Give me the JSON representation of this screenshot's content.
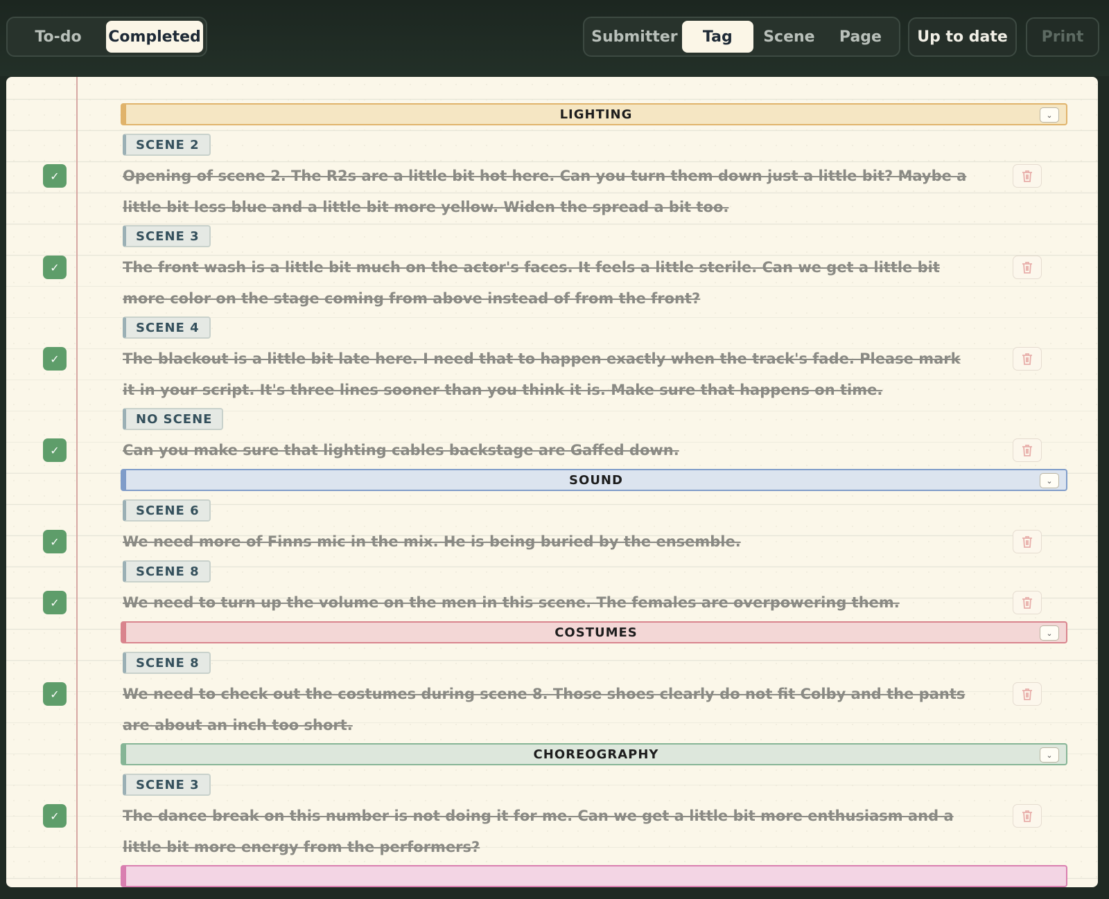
{
  "toolbar": {
    "view_toggle": [
      "To-do",
      "Completed"
    ],
    "active_view": "Completed",
    "group_by": [
      "Submitter",
      "Tag",
      "Scene",
      "Page"
    ],
    "active_group": "Tag",
    "sync_status": "Up to date",
    "print_label": "Print"
  },
  "icons": {
    "check": "✓",
    "chevron_down": "⌄",
    "trash": "trash-icon"
  },
  "groups": [
    {
      "name": "LIGHTING",
      "color": "#e0b36b",
      "bg": "#f5e6c3",
      "scenes": [
        {
          "label": "SCENE 2",
          "notes": [
            "Opening of scene 2. The R2s are a little bit hot here. Can you turn them down just a little bit? Maybe a little bit less blue and a little bit more yellow. Widen the spread a bit too."
          ]
        },
        {
          "label": "SCENE 3",
          "notes": [
            "The front wash is a little bit much on the actor's faces. It feels a little sterile. Can we get a little bit more color on the stage coming from above instead of from the front?"
          ]
        },
        {
          "label": "SCENE 4",
          "notes": [
            "The blackout is a little bit late here. I need that to happen exactly when the track's fade. Please mark it in your script. It's three lines sooner than you think it is. Make sure that happens on time."
          ]
        },
        {
          "label": "NO SCENE",
          "notes": [
            "Can you make sure that lighting cables backstage are Gaffed down."
          ]
        }
      ]
    },
    {
      "name": "SOUND",
      "color": "#7f9cc9",
      "bg": "#dce4ef",
      "scenes": [
        {
          "label": "SCENE 6",
          "notes": [
            "We need more of Finns mic in the mix. He is being buried by the ensemble."
          ]
        },
        {
          "label": "SCENE 8",
          "notes": [
            "We need to turn up the volume on the men in this scene. The females are overpowering them."
          ]
        }
      ]
    },
    {
      "name": "COSTUMES",
      "color": "#d9848d",
      "bg": "#f3d7d6",
      "scenes": [
        {
          "label": "SCENE 8",
          "notes": [
            "We need to check out the costumes during scene 8. Those shoes clearly do not fit Colby and the pants are about an inch too short."
          ]
        }
      ]
    },
    {
      "name": "CHOREOGRAPHY",
      "color": "#86b596",
      "bg": "#dde7dc",
      "scenes": [
        {
          "label": "SCENE 3",
          "notes": [
            "The dance break on this number is not doing it for me. Can we get a little bit more enthusiasm and a little bit more energy from the performers?"
          ]
        }
      ]
    },
    {
      "name": "",
      "color": "#d97fb0",
      "bg": "#f3d5e4",
      "scenes": []
    }
  ]
}
